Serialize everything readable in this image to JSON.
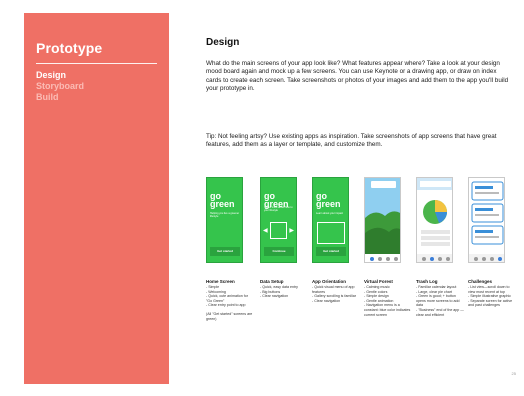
{
  "sidebar": {
    "title": "Prototype",
    "items": [
      {
        "label": "Design",
        "active": true
      },
      {
        "label": "Storyboard",
        "active": false
      },
      {
        "label": "Build",
        "active": false
      }
    ]
  },
  "main": {
    "heading": "Design",
    "paragraph1": "What do the main screens of your app look like? What features appear where? Take a look at your design mood board again and mock up a few screens. You can use Keynote or a drawing app, or draw on index cards to create each screen. Take screenshots or photos of your images and add them to the app you'll build your prototype in.",
    "paragraph2": "Tip: Not feeling artsy? Use existing apps as inspiration. Take screenshots of app screens that have great features, add them as a layer or template, and customize them."
  },
  "screenshots": [
    {
      "big": "go green",
      "small": "Helping you live a greener lifestyle",
      "button": "Get started"
    },
    {
      "big": "go green",
      "small": "Tell us more about how to your lifestyle",
      "button": "Continue"
    },
    {
      "big": "go green",
      "small": "Learn about your impact",
      "button": "Get started"
    },
    {
      "title": "Virtual Forest"
    },
    {
      "title": "Trash Log"
    },
    {
      "title": "Challenges"
    }
  ],
  "descriptions": [
    {
      "title": "Home Screen",
      "lines": [
        "- Simple",
        "- Welcoming",
        "- Quick, cute animation for \"Go Green\"",
        "- Clear entry point to app"
      ],
      "note": "(All \"Get started\" screens are green)"
    },
    {
      "title": "Data Setup",
      "lines": [
        "- Quick, easy data entry",
        "- Big buttons",
        "- Clear navigation"
      ]
    },
    {
      "title": "App Orientation",
      "lines": [
        "- Quick visual menu of app features",
        "- Gallery scrolling is familiar",
        "- Clear navigation"
      ]
    },
    {
      "title": "Virtual Forest",
      "lines": [
        "- Calming music",
        "- Gentle colors",
        "- Simple design",
        "- Gentle animation",
        "- Navigation menu is a constant: blue color indicates current screen"
      ]
    },
    {
      "title": "Trash Log",
      "lines": [
        "- Familiar calendar layout",
        "- Large, clear pie chart",
        "- Green is good; + button opens more screens to add data",
        "- \"Business\" end of the app — clear and efficient"
      ]
    },
    {
      "title": "Challenges",
      "lines": [
        "- List view—scroll down to view most recent at top",
        "- Simple illustrative graphic",
        "- Separate screen for active and past challenges"
      ]
    }
  ],
  "page_number": "25",
  "colors": {
    "sidebar": "#ef7065",
    "green": "#35c44c"
  }
}
